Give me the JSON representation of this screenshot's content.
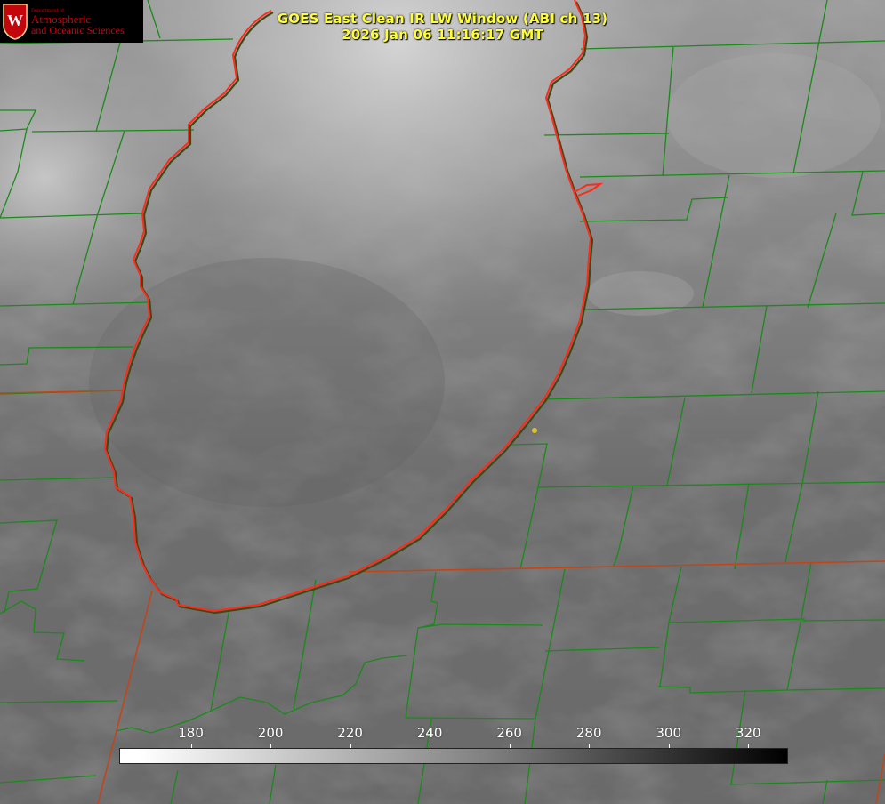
{
  "header": {
    "title_line1": "GOES East Clean IR LW Window (ABI ch 13)",
    "title_line2": "2026 Jan 06 11:16:17 GMT"
  },
  "logo": {
    "department": "Department of",
    "line1": "Atmospheric",
    "line2": "and Oceanic Sciences",
    "seal_letter": "W"
  },
  "colorbar": {
    "label": "",
    "units": "",
    "ticks": [
      "180",
      "200",
      "220",
      "240",
      "260",
      "280",
      "300",
      "320"
    ],
    "range_k": [
      162,
      330
    ],
    "colors": {
      "low": "#ffffff",
      "high": "#000000"
    }
  },
  "map": {
    "product": "clean IR longwave brightness temperature",
    "lake_outline_color": "#ff2a1a",
    "county_line_color": "#1a8a1a",
    "state_line_color": "#c0461a",
    "station_color": "#d8c62a"
  }
}
